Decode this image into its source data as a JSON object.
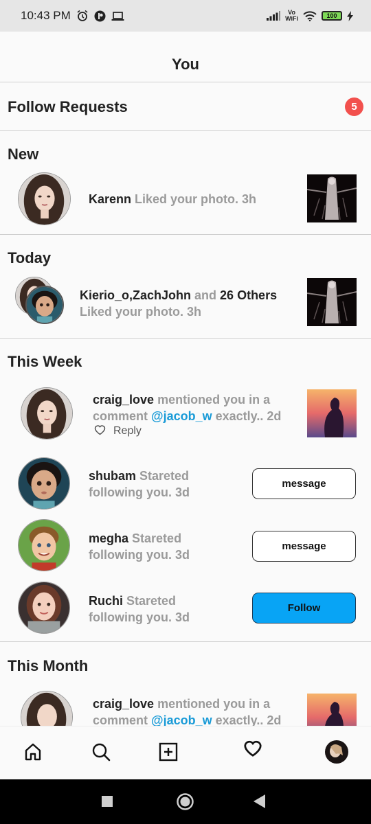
{
  "status": {
    "time": "10:43 PM",
    "vo": "Vo",
    "wifi_label": "WiFi",
    "battery": "100",
    "icons": [
      "alarm-icon",
      "notification-icon",
      "laptop-icon",
      "signal-icon",
      "wifi-icon",
      "battery-icon",
      "charging-icon"
    ]
  },
  "header": {
    "title": "You"
  },
  "follow_requests": {
    "label": "Follow Requests",
    "count": "5",
    "badge_color": "#f2504d"
  },
  "sections": {
    "new": "New",
    "today": "Today",
    "this_week": "This Week",
    "this_month": "This Month"
  },
  "new_item": {
    "user": "Karenn",
    "text": " Liked your photo. 3h"
  },
  "today_item": {
    "users": "Kierio_o,ZachJohn",
    "and": " and ",
    "others": "26 Others",
    "text": "Liked your photo. 3h"
  },
  "week_mention": {
    "user": "craig_love",
    "text1": " mentioned you in a",
    "text2": "comment ",
    "mention": "@jacob_w",
    "text3": " exactly.. 2d",
    "reply": "Reply"
  },
  "week_follows": [
    {
      "user": "shubam",
      "text1": " Stareted",
      "text2": "following you. 3d",
      "button": "message"
    },
    {
      "user": "megha",
      "text1": " Stareted",
      "text2": "following you. 3d",
      "button": "message"
    },
    {
      "user": "Ruchi",
      "text1": " Stareted",
      "text2": "following you. 3d",
      "button": "Follow"
    }
  ],
  "month_mention": {
    "user": "craig_love",
    "text1": " mentioned you in a",
    "text2": "comment ",
    "mention": "@jacob_w",
    "text3": " exactly.. 2d"
  },
  "colors": {
    "accent": "#08a4f5",
    "mention": "#1a9bd7",
    "muted": "#9a9a9a"
  },
  "nav": [
    "home-icon",
    "search-icon",
    "add-post-icon",
    "activity-heart-icon",
    "profile-avatar"
  ],
  "system_nav": [
    "recents-square-icon",
    "home-circle-icon",
    "back-triangle-icon"
  ]
}
